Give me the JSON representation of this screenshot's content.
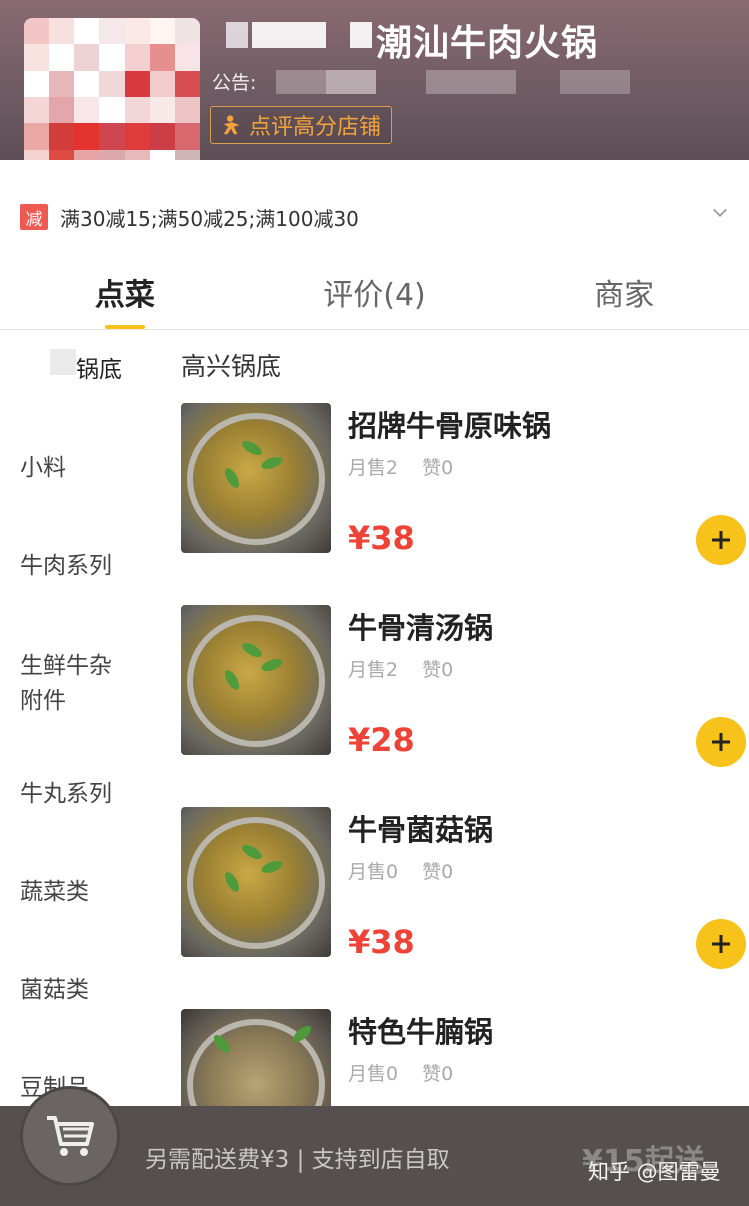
{
  "shop": {
    "name": "潮汕牛肉火锅",
    "notice_label": "公告:",
    "badge": "点评高分店铺"
  },
  "promo": {
    "tag": "减",
    "text": "满30减15;满50减25;满100减30"
  },
  "tabs": [
    {
      "label": "点菜",
      "active": true
    },
    {
      "label": "评价(4)",
      "active": false
    },
    {
      "label": "商家",
      "active": false
    }
  ],
  "categories": [
    {
      "label": "锅底",
      "active": true
    },
    {
      "label": "小料"
    },
    {
      "label": "牛肉系列"
    },
    {
      "label": "生鲜牛杂\n附件"
    },
    {
      "label": "牛丸系列"
    },
    {
      "label": "蔬菜类"
    },
    {
      "label": "菌菇类"
    },
    {
      "label": "豆制品"
    }
  ],
  "section_title": "高兴锅底",
  "items": [
    {
      "name": "招牌牛骨原味锅",
      "sales": "月售2",
      "likes": "赞0",
      "price": "¥38"
    },
    {
      "name": "牛骨清汤锅",
      "sales": "月售2",
      "likes": "赞0",
      "price": "¥28"
    },
    {
      "name": "牛骨菌菇锅",
      "sales": "月售0",
      "likes": "赞0",
      "price": "¥38"
    },
    {
      "name": "特色牛腩锅",
      "sales": "月售0",
      "likes": "赞0",
      "price": ""
    }
  ],
  "cart": {
    "info": "另需配送费¥3 | 支持到店自取",
    "min_order": "¥15起送"
  },
  "watermark": "知乎 @图雷曼",
  "colors": {
    "accent_yellow": "#f7c21a",
    "price_red": "#ee4336",
    "promo_red": "#ee5a52",
    "badge_orange": "#f3a33a"
  },
  "icons": {
    "cart": "cart-icon",
    "add": "plus-icon",
    "expand": "chevron-down-icon",
    "badge": "person-icon"
  }
}
